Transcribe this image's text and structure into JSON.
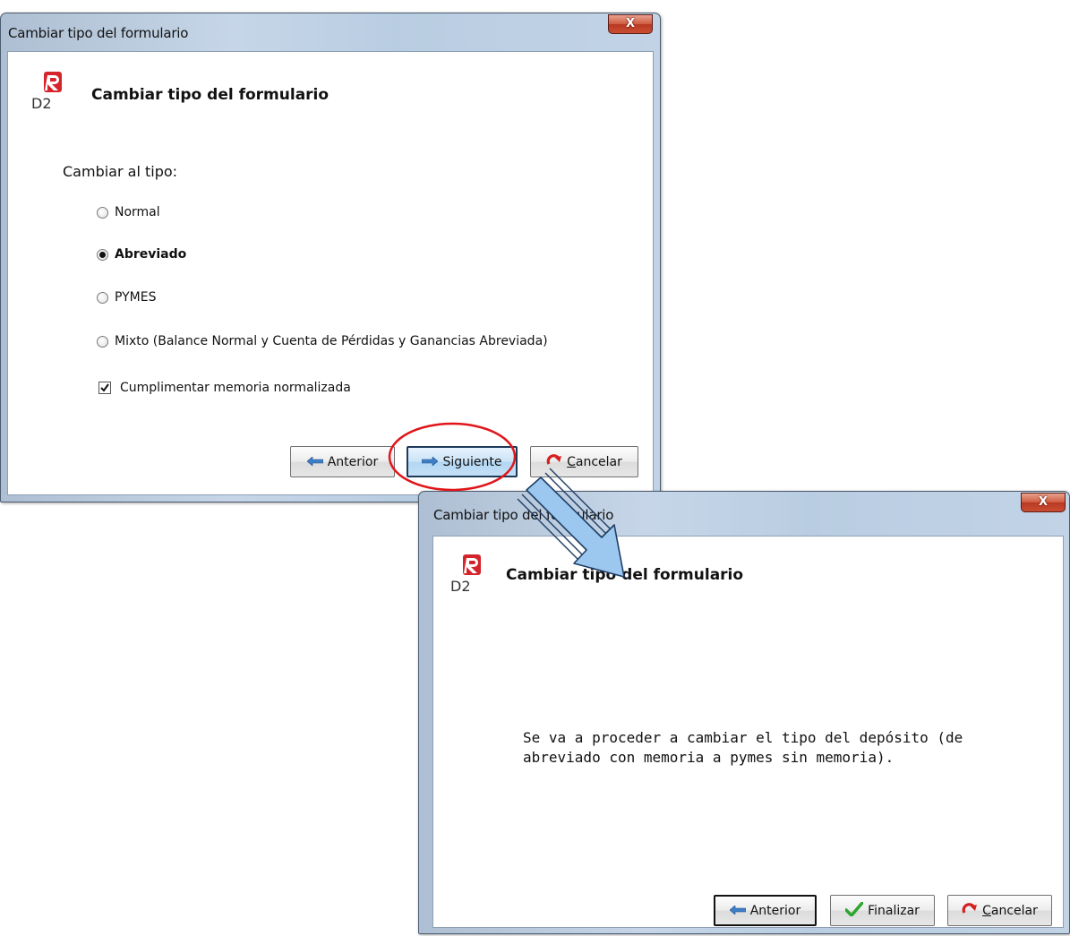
{
  "dialog1": {
    "title": "Cambiar tipo del formulario",
    "close_label": "X",
    "header": "Cambiar tipo del formulario",
    "logo_text": "D2",
    "prompt": "Cambiar al tipo:",
    "options": [
      {
        "label": "Normal",
        "selected": false
      },
      {
        "label": "Abreviado",
        "selected": true
      },
      {
        "label": "PYMES",
        "selected": false
      },
      {
        "label": "Mixto (Balance Normal y Cuenta de Pérdidas y Ganancias Abreviada)",
        "selected": false
      }
    ],
    "checkbox": {
      "label": "Cumplimentar memoria normalizada",
      "checked": true
    },
    "buttons": {
      "back": "Anterior",
      "next": "Siguiente",
      "cancel_first": "C",
      "cancel_rest": "ancelar"
    }
  },
  "dialog2": {
    "title": "Cambiar tipo del formulario",
    "close_label": "X",
    "header": "Cambiar tipo del formulario",
    "logo_text": "D2",
    "message_line1": "Se va a proceder a cambiar el tipo del depósito (de",
    "message_line2": "abreviado con memoria a pymes sin memoria).",
    "buttons": {
      "back": "Anterior",
      "finish": "Finalizar",
      "cancel_first": "C",
      "cancel_rest": "ancelar"
    }
  },
  "colors": {
    "highlight_circle": "#e0161a",
    "arrow_fill": "#9cc8ef",
    "logo_red": "#d4252c"
  },
  "icons": [
    "arrow-left-icon",
    "arrow-right-icon",
    "cancel-icon",
    "checkmark-icon",
    "logo-icon"
  ]
}
